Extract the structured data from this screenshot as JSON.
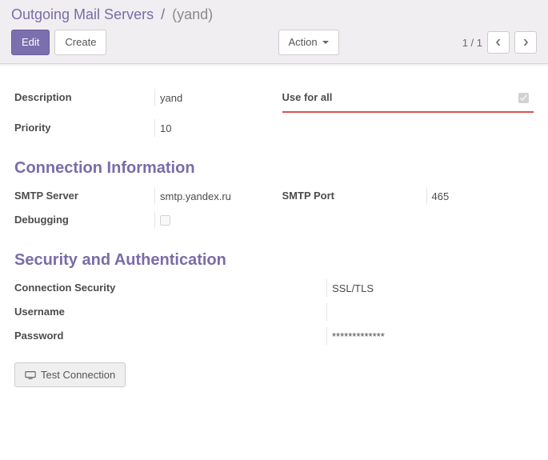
{
  "breadcrumb": {
    "parent": "Outgoing Mail Servers",
    "sep": "/",
    "current": "(yand)"
  },
  "toolbar": {
    "edit": "Edit",
    "create": "Create",
    "action": "Action"
  },
  "pager": {
    "text": "1 / 1"
  },
  "form": {
    "description_label": "Description",
    "description_value": "yand",
    "priority_label": "Priority",
    "priority_value": "10",
    "useforall_label": "Use for all"
  },
  "section_connection": {
    "title": "Connection Information",
    "smtp_server_label": "SMTP Server",
    "smtp_server_value": "smtp.yandex.ru",
    "smtp_port_label": "SMTP Port",
    "smtp_port_value": "465",
    "debugging_label": "Debugging"
  },
  "section_security": {
    "title": "Security and Authentication",
    "conn_sec_label": "Connection Security",
    "conn_sec_value": "SSL/TLS",
    "username_label": "Username",
    "username_value": "",
    "password_label": "Password",
    "password_value": "*************",
    "test_button": "Test Connection"
  }
}
